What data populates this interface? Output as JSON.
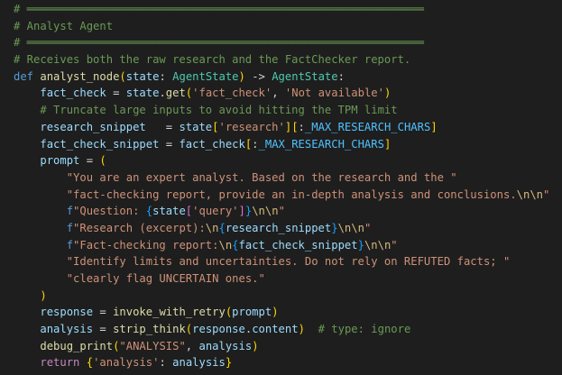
{
  "editor": {
    "language": "python",
    "theme": {
      "background": "#1e1e1e",
      "comment": "#6a9955",
      "keyword": "#569cd6",
      "function": "#dcdcaa",
      "variable": "#9cdcfe",
      "type": "#4ec9b0",
      "constant": "#4fc1ff",
      "string": "#ce9178",
      "escape": "#d7ba7d",
      "text": "#d4d4d4"
    },
    "lines": [
      [
        [
          "comment",
          "# ════════════════════════════════════════════════════════════"
        ]
      ],
      [
        [
          "comment",
          "# Analyst Agent"
        ]
      ],
      [
        [
          "comment",
          "# ════════════════════════════════════════════════════════════"
        ]
      ],
      [
        [
          "comment",
          "# Receives both the raw research and the FactChecker report."
        ]
      ],
      [
        [
          "keyword",
          "def"
        ],
        [
          "text",
          " "
        ],
        [
          "func",
          "analyst_node"
        ],
        [
          "brace1",
          "("
        ],
        [
          "param",
          "state"
        ],
        [
          "text",
          ": "
        ],
        [
          "type",
          "AgentState"
        ],
        [
          "brace1",
          ")"
        ],
        [
          "text",
          " -> "
        ],
        [
          "type",
          "AgentState"
        ],
        [
          "text",
          ":"
        ]
      ],
      [
        [
          "text",
          "    "
        ],
        [
          "var",
          "fact_check"
        ],
        [
          "text",
          " = "
        ],
        [
          "var",
          "state"
        ],
        [
          "text",
          "."
        ],
        [
          "func",
          "get"
        ],
        [
          "brace1",
          "("
        ],
        [
          "string",
          "'fact_check'"
        ],
        [
          "text",
          ", "
        ],
        [
          "string",
          "'Not available'"
        ],
        [
          "brace1",
          ")"
        ]
      ],
      [
        [
          "text",
          "    "
        ],
        [
          "comment",
          "# Truncate large inputs to avoid hitting the TPM limit"
        ]
      ],
      [
        [
          "text",
          "    "
        ],
        [
          "var",
          "research_snippet"
        ],
        [
          "text",
          "   = "
        ],
        [
          "var",
          "state"
        ],
        [
          "brace1",
          "["
        ],
        [
          "string",
          "'research'"
        ],
        [
          "brace1",
          "]"
        ],
        [
          "brace1",
          "["
        ],
        [
          "text",
          ":"
        ],
        [
          "const",
          "_MAX_RESEARCH_CHARS"
        ],
        [
          "brace1",
          "]"
        ]
      ],
      [
        [
          "text",
          "    "
        ],
        [
          "var",
          "fact_check_snippet"
        ],
        [
          "text",
          " = "
        ],
        [
          "var",
          "fact_check"
        ],
        [
          "brace1",
          "["
        ],
        [
          "text",
          ":"
        ],
        [
          "const",
          "_MAX_RESEARCH_CHARS"
        ],
        [
          "brace1",
          "]"
        ]
      ],
      [
        [
          "text",
          "    "
        ],
        [
          "var",
          "prompt"
        ],
        [
          "text",
          " = "
        ],
        [
          "brace1",
          "("
        ]
      ],
      [
        [
          "text",
          "        "
        ],
        [
          "string",
          "\"You are an expert analyst. Based on the research and the \""
        ]
      ],
      [
        [
          "text",
          "        "
        ],
        [
          "string",
          "\"fact-checking report, provide an in-depth analysis and conclusions."
        ],
        [
          "escape",
          "\\n\\n"
        ],
        [
          "string",
          "\""
        ]
      ],
      [
        [
          "text",
          "        "
        ],
        [
          "keyword",
          "f"
        ],
        [
          "string",
          "\"Question: "
        ],
        [
          "brace3",
          "{"
        ],
        [
          "var",
          "state"
        ],
        [
          "brace2",
          "["
        ],
        [
          "string",
          "'query'"
        ],
        [
          "brace2",
          "]"
        ],
        [
          "brace3",
          "}"
        ],
        [
          "escape",
          "\\n\\n"
        ],
        [
          "string",
          "\""
        ]
      ],
      [
        [
          "text",
          "        "
        ],
        [
          "keyword",
          "f"
        ],
        [
          "string",
          "\"Research (excerpt):"
        ],
        [
          "escape",
          "\\n"
        ],
        [
          "brace3",
          "{"
        ],
        [
          "var",
          "research_snippet"
        ],
        [
          "brace3",
          "}"
        ],
        [
          "escape",
          "\\n\\n"
        ],
        [
          "string",
          "\""
        ]
      ],
      [
        [
          "text",
          "        "
        ],
        [
          "keyword",
          "f"
        ],
        [
          "string",
          "\"Fact-checking report:"
        ],
        [
          "escape",
          "\\n"
        ],
        [
          "brace3",
          "{"
        ],
        [
          "var",
          "fact_check_snippet"
        ],
        [
          "brace3",
          "}"
        ],
        [
          "escape",
          "\\n\\n"
        ],
        [
          "string",
          "\""
        ]
      ],
      [
        [
          "text",
          "        "
        ],
        [
          "string",
          "\"Identify limits and uncertainties. Do not rely on REFUTED facts; \""
        ]
      ],
      [
        [
          "text",
          "        "
        ],
        [
          "string",
          "\"clearly flag UNCERTAIN ones.\""
        ]
      ],
      [
        [
          "text",
          "    "
        ],
        [
          "brace1",
          ")"
        ]
      ],
      [
        [
          "text",
          "    "
        ],
        [
          "var",
          "response"
        ],
        [
          "text",
          " = "
        ],
        [
          "func",
          "invoke_with_retry"
        ],
        [
          "brace1",
          "("
        ],
        [
          "var",
          "prompt"
        ],
        [
          "brace1",
          ")"
        ]
      ],
      [
        [
          "text",
          "    "
        ],
        [
          "var",
          "analysis"
        ],
        [
          "text",
          " = "
        ],
        [
          "func",
          "strip_think"
        ],
        [
          "brace1",
          "("
        ],
        [
          "var",
          "response"
        ],
        [
          "text",
          "."
        ],
        [
          "var",
          "content"
        ],
        [
          "brace1",
          ")"
        ],
        [
          "text",
          "  "
        ],
        [
          "comment",
          "# type: ignore"
        ]
      ],
      [
        [
          "text",
          "    "
        ],
        [
          "func",
          "debug_print"
        ],
        [
          "brace1",
          "("
        ],
        [
          "string",
          "\"ANALYSIS\""
        ],
        [
          "text",
          ", "
        ],
        [
          "var",
          "analysis"
        ],
        [
          "brace1",
          ")"
        ]
      ],
      [
        [
          "text",
          "    "
        ],
        [
          "ctrl",
          "return"
        ],
        [
          "text",
          " "
        ],
        [
          "brace1",
          "{"
        ],
        [
          "string",
          "'analysis'"
        ],
        [
          "text",
          ": "
        ],
        [
          "var",
          "analysis"
        ],
        [
          "brace1",
          "}"
        ]
      ]
    ]
  }
}
